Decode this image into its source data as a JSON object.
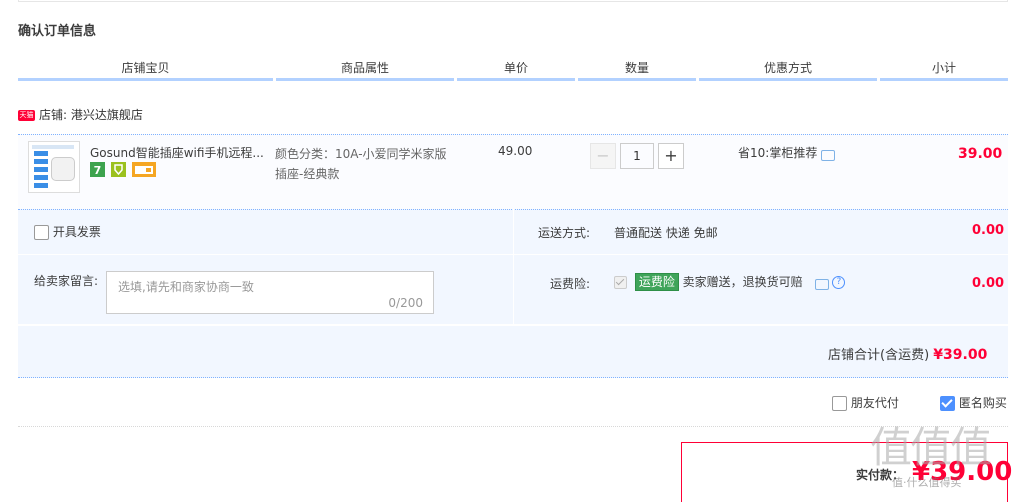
{
  "page": {
    "title": "确认订单信息"
  },
  "table_header": {
    "columns": [
      "店铺宝贝",
      "商品属性",
      "单价",
      "数量",
      "优惠方式",
      "小计"
    ]
  },
  "shop": {
    "badge": "天猫",
    "label": "店铺: 港兴达旗舰店"
  },
  "item": {
    "name": "Gosund智能插座wifi手机远程...",
    "property_line1": "颜色分类：10A-小爱同学米家版",
    "property_line2": "插座-经典款",
    "price": "49.00",
    "quantity": "1",
    "decrement": "−",
    "increment": "+",
    "promo": "省10:掌柜推荐",
    "subtotal": "39.00"
  },
  "invoice": {
    "label": "开具发票"
  },
  "shipping": {
    "label": "运送方式:",
    "value": "普通配送 快递 免邮",
    "cost": "0.00"
  },
  "message": {
    "label": "给卖家留言:",
    "placeholder": "选填,请先和商家协商一致",
    "counter": "0/200"
  },
  "insurance": {
    "label": "运费险:",
    "tag": "运费险",
    "desc": "卖家赠送，退换货可赔",
    "cost": "0.00"
  },
  "shop_total": {
    "label": "店铺合计(含运费)",
    "value": "¥39.00"
  },
  "options": {
    "friend_pay": "朋友代付",
    "anonymous": "匿名购买"
  },
  "payment": {
    "label": "实付款：",
    "amount": "¥39.00"
  },
  "watermark": {
    "text": "值值值",
    "url": "值·什么值得买"
  },
  "colors": {
    "accent": "#ff0036",
    "blue": "#4d90fe",
    "info_bg": "#f2f7ff"
  }
}
